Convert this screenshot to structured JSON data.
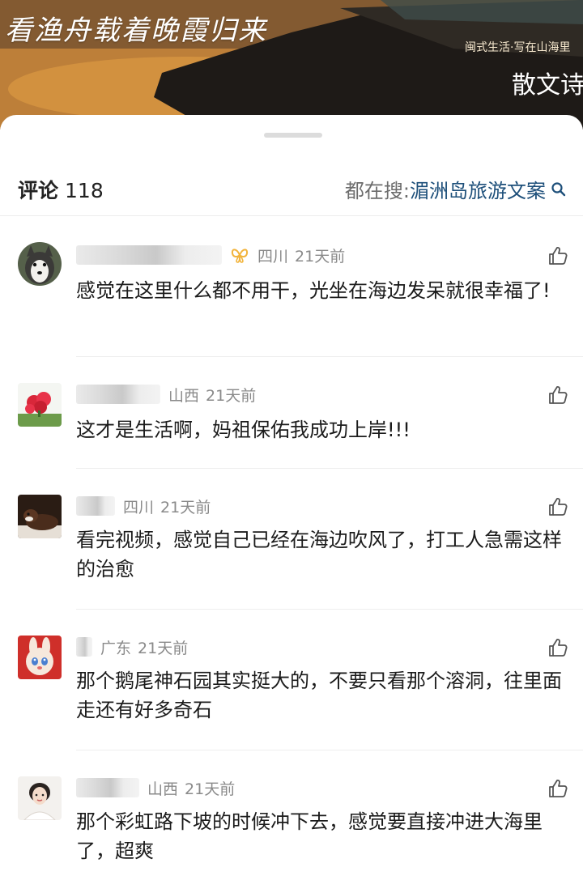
{
  "banner": {
    "title": "看渔舟载着晚霞归来",
    "series": "闽式生活·写在山海里",
    "genre": "散文诗"
  },
  "comments_header": {
    "label": "评论",
    "count": "118",
    "search_label": "都在搜:",
    "search_keyword": "湄洲岛旅游文案",
    "search_icon": "search-icon"
  },
  "colors": {
    "keyword": "#1d4f7a",
    "meta_text": "#8a8a8a",
    "vip_badge": "#f2b43c"
  },
  "comments": [
    {
      "avatar": "husky-dog-avatar",
      "vip_icon": "butterfly-vip-icon",
      "location": "四川",
      "time": "21天前",
      "text": "感觉在这里什么都不用干，光坐在海边发呆就很幸福了!",
      "like_icon": "thumbs-up-icon"
    },
    {
      "avatar": "red-flowers-avatar",
      "location": "山西",
      "time": "21天前",
      "text": "这才是生活啊，妈祖保佑我成功上岸!!!",
      "like_icon": "thumbs-up-icon"
    },
    {
      "avatar": "dog-lying-avatar",
      "location": "四川",
      "time": "21天前",
      "text": "看完视频，感觉自己已经在海边吹风了，打工人急需这样的治愈",
      "like_icon": "thumbs-up-icon"
    },
    {
      "avatar": "cartoon-bunny-avatar",
      "location": "广东",
      "time": "21天前",
      "text": "那个鹅尾神石园其实挺大的，不要只看那个溶洞，往里面走还有好多奇石",
      "like_icon": "thumbs-up-icon"
    },
    {
      "avatar": "girl-portrait-avatar",
      "location": "山西",
      "time": "21天前",
      "text": "那个彩虹路下坡的时候冲下去，感觉要直接冲进大海里了，超爽",
      "like_icon": "thumbs-up-icon"
    }
  ]
}
